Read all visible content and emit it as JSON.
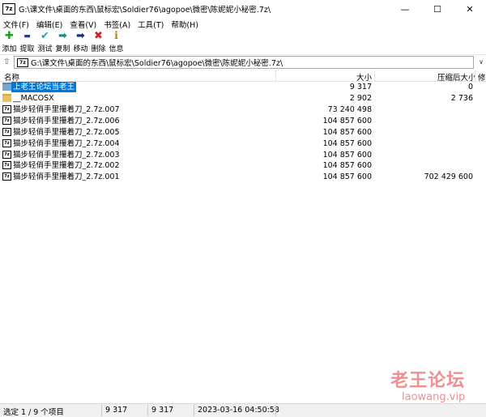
{
  "window": {
    "app_icon": "7z",
    "title": "G:\\课文件\\桌面的东西\\鼠标宏\\Soldier76\\agopoe\\微密\\陈妮妮小秘密.7z\\",
    "min_glyph": "—",
    "max_glyph": "☐",
    "close_glyph": "✕"
  },
  "menu": [
    {
      "label": "文件(F)"
    },
    {
      "label": "编辑(E)"
    },
    {
      "label": "查看(V)"
    },
    {
      "label": "书签(A)"
    },
    {
      "label": "工具(T)"
    },
    {
      "label": "帮助(H)"
    }
  ],
  "toolbar": [
    {
      "label": "添加",
      "icon": "plus-icon",
      "glyph": "✚",
      "color": "#1f9e1f"
    },
    {
      "label": "提取",
      "icon": "minus-icon",
      "glyph": "▬",
      "color": "#1c3ea8"
    },
    {
      "label": "测试",
      "icon": "check-icon",
      "glyph": "✔",
      "color": "#2aa4b4"
    },
    {
      "label": "复制",
      "icon": "copy-arrow-icon",
      "glyph": "➡",
      "color": "#1b8f8f"
    },
    {
      "label": "移动",
      "icon": "move-arrow-icon",
      "glyph": "➡",
      "color": "#1c2f8a"
    },
    {
      "label": "删除",
      "icon": "delete-x-icon",
      "glyph": "✖",
      "color": "#d21f1f"
    },
    {
      "label": "信息",
      "icon": "info-icon",
      "glyph": "ℹ",
      "color": "#b08a10"
    }
  ],
  "address": {
    "up_glyph": "⇧",
    "path": "G:\\课文件\\桌面的东西\\鼠标宏\\Soldier76\\agopoe\\微密\\陈妮妮小秘密.7z\\",
    "dropdown_glyph": "∨"
  },
  "columns": {
    "name": "名称",
    "size": "大小",
    "packed": "压缩后大小",
    "extra": "修"
  },
  "files": [
    {
      "name": "上老王论坛当老王",
      "size": "9 317",
      "packed": "0",
      "type": "folder",
      "selected": true
    },
    {
      "name": "__MACOSX",
      "size": "2 902",
      "packed": "2 736",
      "type": "folder",
      "selected": false
    },
    {
      "name": "猫步轻俏手里攥着刀_2.7z.007",
      "size": "73 240 498",
      "packed": "",
      "type": "7z",
      "selected": false
    },
    {
      "name": "猫步轻俏手里攥着刀_2.7z.006",
      "size": "104 857 600",
      "packed": "",
      "type": "7z",
      "selected": false
    },
    {
      "name": "猫步轻俏手里攥着刀_2.7z.005",
      "size": "104 857 600",
      "packed": "",
      "type": "7z",
      "selected": false
    },
    {
      "name": "猫步轻俏手里攥着刀_2.7z.004",
      "size": "104 857 600",
      "packed": "",
      "type": "7z",
      "selected": false
    },
    {
      "name": "猫步轻俏手里攥着刀_2.7z.003",
      "size": "104 857 600",
      "packed": "",
      "type": "7z",
      "selected": false
    },
    {
      "name": "猫步轻俏手里攥着刀_2.7z.002",
      "size": "104 857 600",
      "packed": "",
      "type": "7z",
      "selected": false
    },
    {
      "name": "猫步轻俏手里攥着刀_2.7z.001",
      "size": "104 857 600",
      "packed": "702 429 600",
      "type": "7z",
      "selected": false
    }
  ],
  "watermark": {
    "text": "老王论坛",
    "url": "laowang.vip",
    "color": "#ef8f8f"
  },
  "status": {
    "selection": "选定 1 / 9 个项目",
    "size": "9 317",
    "packed": "9 317",
    "modified": "2023-03-16 04:50:58"
  },
  "colors": {
    "selection": "#0078d7"
  }
}
